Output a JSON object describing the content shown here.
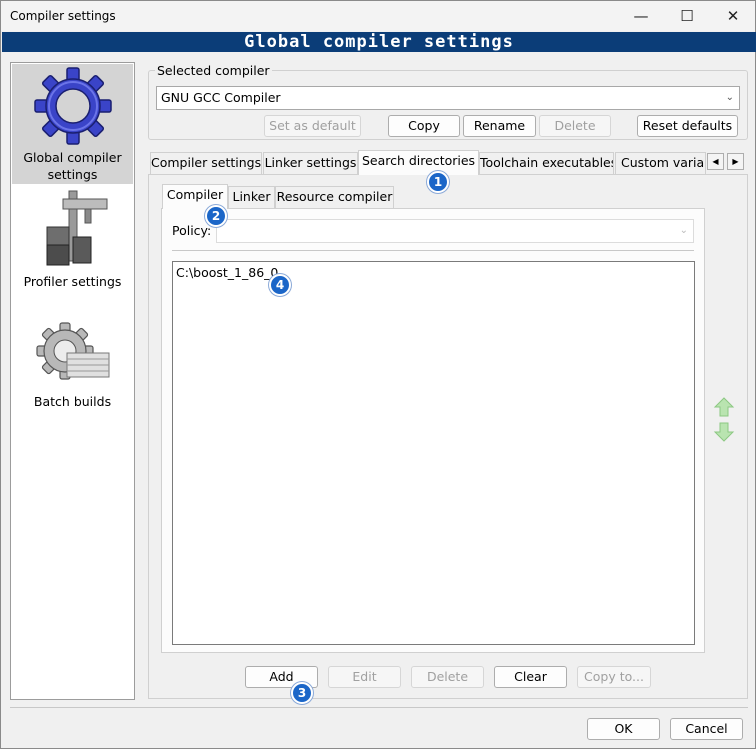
{
  "window": {
    "title": "Compiler settings",
    "minimize_glyph": "—",
    "maximize_glyph": "☐",
    "close_glyph": "✕"
  },
  "banner": {
    "text": "Global compiler settings"
  },
  "nav": {
    "items": [
      {
        "label": "Global compiler settings",
        "icon": "gear-icon",
        "selected": true
      },
      {
        "label": "Profiler settings",
        "icon": "caliper-icon",
        "selected": false
      },
      {
        "label": "Batch builds",
        "icon": "batch-gear-icon",
        "selected": false
      }
    ]
  },
  "selected_compiler": {
    "group_label": "Selected compiler",
    "value": "GNU GCC Compiler",
    "buttons": {
      "set_default": "Set as default",
      "copy": "Copy",
      "rename": "Rename",
      "delete": "Delete",
      "reset": "Reset defaults"
    }
  },
  "main_tabs": [
    {
      "label": "Compiler settings",
      "active": false
    },
    {
      "label": "Linker settings",
      "active": false
    },
    {
      "label": "Search directories",
      "active": true
    },
    {
      "label": "Toolchain executables",
      "active": false
    },
    {
      "label": "Custom variab",
      "active": false
    }
  ],
  "sub_tabs": [
    {
      "label": "Compiler",
      "active": true
    },
    {
      "label": "Linker",
      "active": false
    },
    {
      "label": "Resource compiler",
      "active": false
    }
  ],
  "policy": {
    "label": "Policy:",
    "value": ""
  },
  "directories": [
    "C:\\boost_1_86_0"
  ],
  "list_buttons": {
    "add": "Add",
    "edit": "Edit",
    "delete": "Delete",
    "clear": "Clear",
    "copy_to": "Copy to..."
  },
  "footer": {
    "ok": "OK",
    "cancel": "Cancel"
  },
  "badges": [
    "1",
    "2",
    "3",
    "4"
  ],
  "colors": {
    "banner": "#0b3d78",
    "badge": "#1b66c8",
    "arrow_green": "#7cc576"
  }
}
